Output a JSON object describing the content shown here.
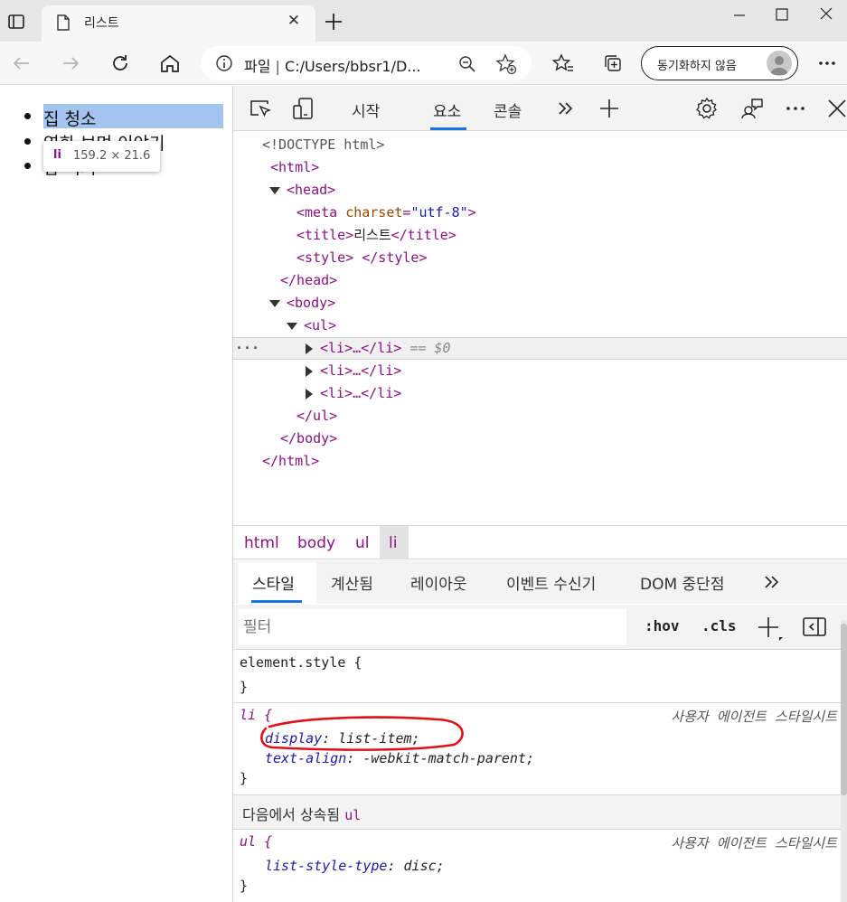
{
  "browser": {
    "tab_title": "리스트",
    "address": "C:/Users/bbsr1/D...",
    "address_prefix": "파일",
    "sync_label": "동기화하지 않음"
  },
  "page": {
    "list_items": [
      "집 청소",
      "영화 보며 이야기",
      "밥 먹기"
    ],
    "tooltip_tag": "li",
    "tooltip_size": "159.2 × 21.6"
  },
  "devtools": {
    "tabs": [
      "시작",
      "요소",
      "콘솔"
    ],
    "active_tab": "요소",
    "dom": {
      "doctype": "<!DOCTYPE html>",
      "html_open": "<html>",
      "head_open": "<head>",
      "meta": "<meta charset=\"utf-8\">",
      "title_text": "리스트",
      "style_line": "<style> </style>",
      "head_close": "</head>",
      "body_open": "<body>",
      "ul_open": "<ul>",
      "li_collapsed": "<li>…</li>",
      "selected_marker": "== $0",
      "ul_close": "</ul>",
      "body_close": "</body>",
      "html_close": "</html>"
    },
    "breadcrumbs": [
      "html",
      "body",
      "ul",
      "li"
    ],
    "style_tabs": [
      "스타일",
      "계산됨",
      "레이아웃",
      "이벤트 수신기",
      "DOM 중단점"
    ],
    "filter_placeholder": "필터",
    "hov": ":hov",
    "cls": ".cls",
    "rules": {
      "element_style": "element.style {",
      "close_brace": "}",
      "li_selector": "li {",
      "ua_label": "사용자 에이전트 스타일시트",
      "li_prop1_name": "display",
      "li_prop1_value": "list-item;",
      "li_prop2_name": "text-align",
      "li_prop2_value": "-webkit-match-parent;",
      "inherited_label": "다음에서 상속됨",
      "inherited_from": "ul",
      "ul_selector": "ul {",
      "ul_prop_name": "list-style-type",
      "ul_prop_value": "disc;"
    }
  },
  "colors": {
    "tag": "#881280",
    "highlight": "#a2c4ee",
    "accent": "#1a73e8",
    "annotation": "#e0101a"
  }
}
